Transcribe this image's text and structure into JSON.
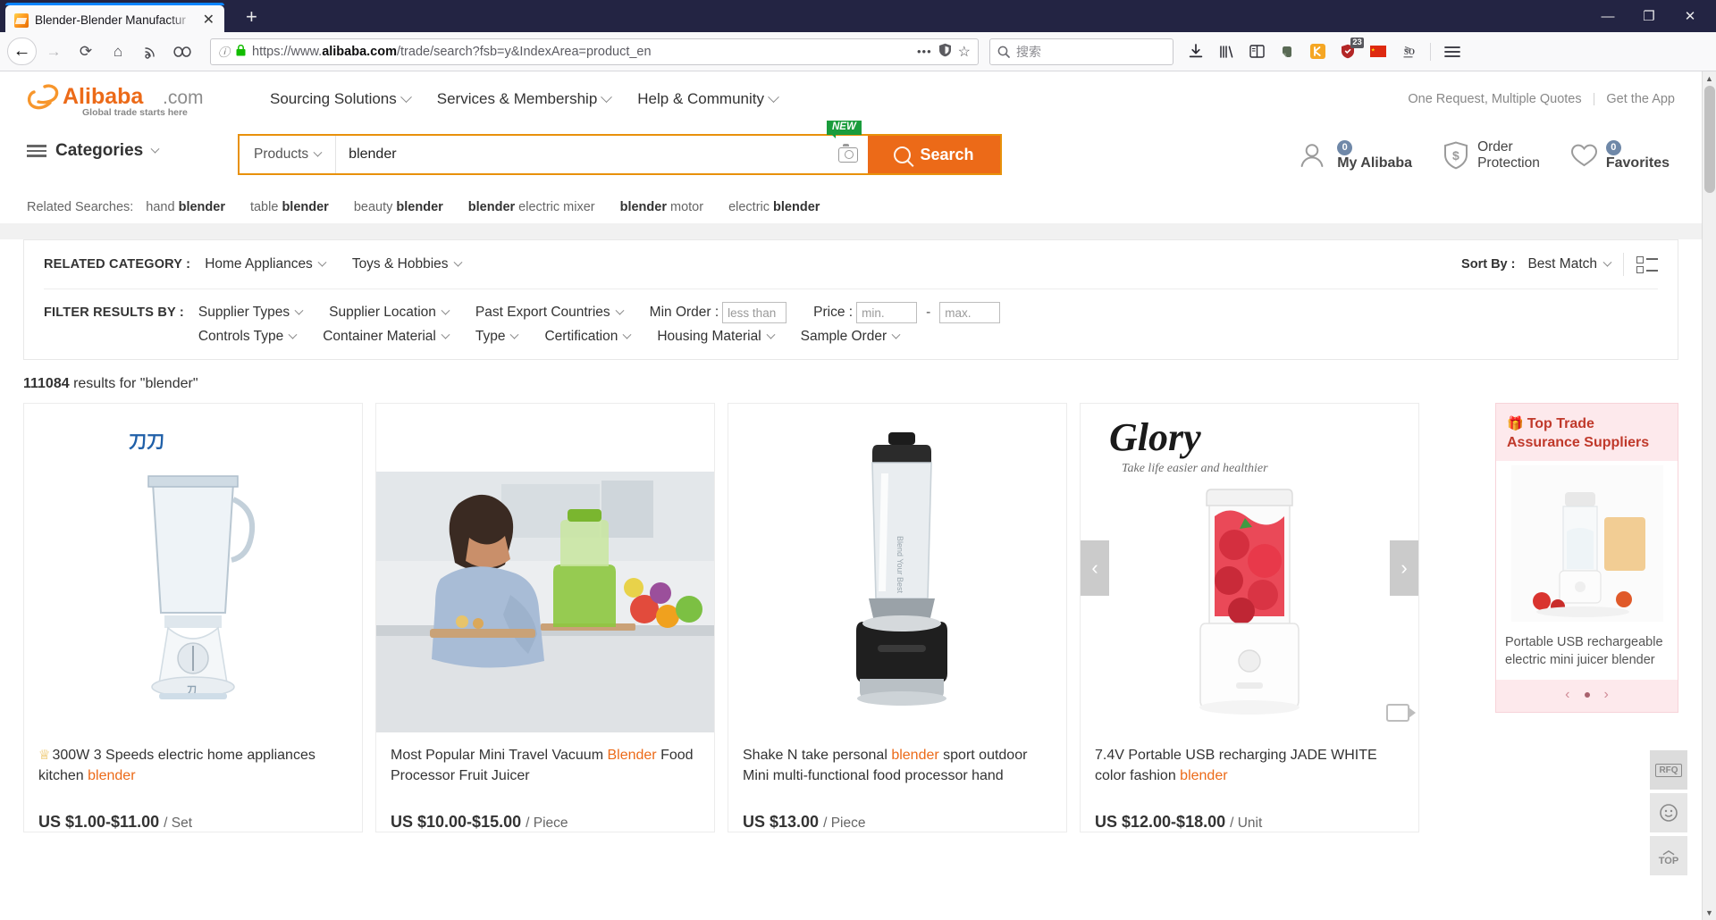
{
  "browser": {
    "tab": {
      "title": "Blender-Blender Manufactur",
      "close": "✕",
      "favicon": "alibaba-favicon"
    },
    "newtab_label": "+",
    "window_controls": {
      "minimize": "—",
      "maximize": "❐",
      "close": "✕"
    },
    "nav": {
      "back": "←",
      "forward": "→",
      "reload": "⟳",
      "home": "⌂",
      "feed": "rss-icon",
      "pocket": "pocket-icon"
    },
    "url": {
      "scheme": "https://www.",
      "domain": "alibaba.com",
      "path": "/trade/search?fsb=y&IndexArea=product_en",
      "info": "ⓘ",
      "lock": "🔒"
    },
    "url_actions": {
      "more": "•••",
      "shield": "shield-icon",
      "bookmark": "☆"
    },
    "search": {
      "placeholder": "搜索",
      "icon": "search-icon"
    },
    "toolbar_icons": [
      {
        "name": "downloads-icon",
        "glyph": "⭳",
        "badge": ""
      },
      {
        "name": "library-icon",
        "glyph": "❙❙❙",
        "badge": ""
      },
      {
        "name": "sidebar-icon",
        "glyph": "▤",
        "badge": ""
      },
      {
        "name": "evernote-icon",
        "glyph": "🐘",
        "badge": ""
      },
      {
        "name": "extension-orange-icon",
        "glyph": "◪",
        "badge": ""
      },
      {
        "name": "adblock-shield-icon",
        "glyph": "🛡",
        "badge": "23"
      },
      {
        "name": "china-flag-icon",
        "glyph": "▮",
        "badge": ""
      },
      {
        "name": "stackoverflow-icon",
        "glyph": "SO",
        "badge": ""
      },
      {
        "name": "menu-hamburger-icon",
        "glyph": "☰",
        "badge": ""
      }
    ]
  },
  "site": {
    "logo": {
      "brand": "Alibaba",
      "suffix": ".com",
      "tagline": "Global trade starts here"
    },
    "topnav": [
      {
        "label": "Sourcing Solutions"
      },
      {
        "label": "Services & Membership"
      },
      {
        "label": "Help & Community"
      }
    ],
    "top_right": {
      "quotes": "One Request, Multiple Quotes",
      "pipe": "|",
      "app": "Get the App"
    },
    "categories_label": "Categories",
    "search": {
      "type_selector": "Products",
      "value": "blender",
      "button": "Search",
      "camera_badge": "NEW"
    },
    "related": {
      "label": "Related Searches:",
      "items": [
        {
          "pre": "hand ",
          "bold": "blender",
          "post": ""
        },
        {
          "pre": "table ",
          "bold": "blender",
          "post": ""
        },
        {
          "pre": "beauty ",
          "bold": "blender",
          "post": ""
        },
        {
          "pre": "",
          "bold": "blender",
          "post": " electric mixer"
        },
        {
          "pre": "",
          "bold": "blender",
          "post": " motor"
        },
        {
          "pre": "electric ",
          "bold": "blender",
          "post": ""
        }
      ]
    },
    "account": {
      "my_alibaba": "My Alibaba",
      "my_alibaba_badge": "0",
      "order_line1": "Order",
      "order_line2": "Protection",
      "favorites": "Favorites",
      "favorites_badge": "0"
    }
  },
  "filters": {
    "related_category_label": "RELATED CATEGORY :",
    "related_categories": [
      {
        "label": "Home Appliances"
      },
      {
        "label": "Toys & Hobbies"
      }
    ],
    "filter_label": "FILTER RESULTS BY :",
    "dropdowns_row1": [
      {
        "label": "Supplier Types"
      },
      {
        "label": "Supplier Location"
      },
      {
        "label": "Past Export Countries"
      }
    ],
    "min_order": {
      "label": "Min Order :",
      "placeholder": "less than"
    },
    "price": {
      "label": "Price :",
      "min_placeholder": "min.",
      "max_placeholder": "max.",
      "dash": "-"
    },
    "dropdowns_row2": [
      {
        "label": "Controls Type"
      },
      {
        "label": "Container Material"
      },
      {
        "label": "Type"
      },
      {
        "label": "Certification"
      },
      {
        "label": "Housing Material"
      },
      {
        "label": "Sample Order"
      }
    ],
    "sort": {
      "label": "Sort By :",
      "value": "Best Match",
      "view_icon": "list-view-icon"
    }
  },
  "results": {
    "count": "111084",
    "suffix": "results for \"blender\""
  },
  "products": [
    {
      "badge": "♕",
      "title_parts": [
        {
          "t": "300W 3 Speeds electric home appliances kitchen ",
          "hl": false
        },
        {
          "t": "blender",
          "hl": true
        }
      ],
      "price": "US $1.00-$11.00",
      "unit": "/ Set",
      "image": "countertop-blender-white"
    },
    {
      "badge": "",
      "title_parts": [
        {
          "t": "Most Popular Mini Travel Vacuum ",
          "hl": false
        },
        {
          "t": "Blender",
          "hl": true
        },
        {
          "t": " Food Processor Fruit Juicer",
          "hl": false
        }
      ],
      "price": "US $10.00-$15.00",
      "unit": "/ Piece",
      "image": "woman-kitchen-green-juicer"
    },
    {
      "badge": "",
      "title_parts": [
        {
          "t": "Shake N take personal ",
          "hl": false
        },
        {
          "t": "blender",
          "hl": true
        },
        {
          "t": " sport outdoor Mini multi-functional food processor hand",
          "hl": false
        }
      ],
      "price": "US $13.00",
      "unit": "/ Piece",
      "image": "black-silver-personal-blender"
    },
    {
      "badge": "",
      "title_parts": [
        {
          "t": "7.4V Portable USB recharging JADE WHITE color fashion ",
          "hl": false
        },
        {
          "t": "blender",
          "hl": true
        }
      ],
      "price": "US $12.00-$18.00",
      "unit": "/ Unit",
      "image": "glory-strawberry-blender",
      "watermark": "Glory",
      "watermark_sub": "Take life easier and healthier",
      "arrows": {
        "prev": "‹",
        "next": "›"
      },
      "video_icon": "video-icon"
    }
  ],
  "promo": {
    "icon": "gift-icon",
    "title": "Top Trade Assurance Suppliers",
    "caption": "Portable USB rechargeable electric mini juicer blender",
    "nav": {
      "prev": "‹",
      "dot": "•",
      "next": "›"
    }
  },
  "floating_toolbar": [
    {
      "name": "rfq-button",
      "label": "RFQ"
    },
    {
      "name": "chat-button",
      "label": "☺"
    },
    {
      "name": "back-to-top-button",
      "label": "TOP",
      "caret": "︿"
    }
  ],
  "colors": {
    "accent_orange": "#ec6a18",
    "search_border": "#e8910b",
    "promo_red": "#c0392b",
    "promo_bg": "#fde9ec",
    "chrome_dark": "#232443"
  }
}
